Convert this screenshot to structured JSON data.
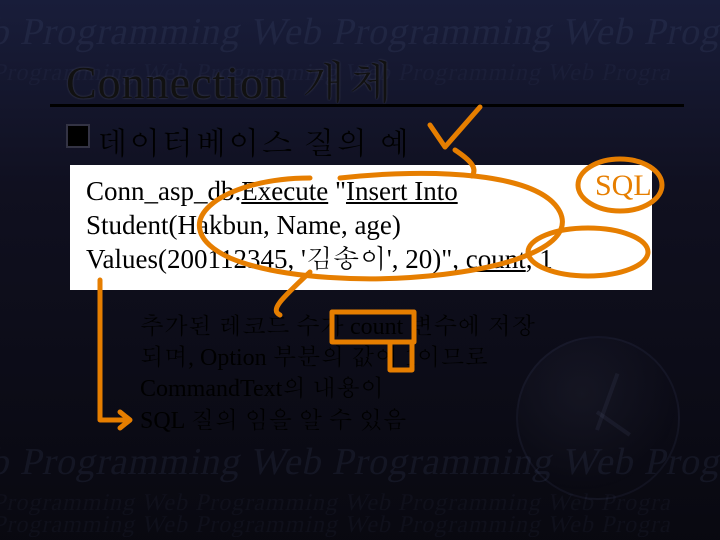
{
  "bg_repeat_text": "Web Programming Web Programming Web Programming Web Progra",
  "title": "Connection 개체",
  "bullet": "데이터베이스 질의 예",
  "code": {
    "part1": "Conn_asp_db.",
    "exec": "Execute",
    "part2": " \"",
    "insert": "Insert Into",
    "line2a": "Student(Hakbun, Name, age)",
    "line3a": "Values(200112345, '김송이', 20)\"",
    "line3b": ", ",
    "count": "count",
    "line3c": ", 1"
  },
  "note_sql": "SQL",
  "explain": {
    "l1a": "추가된 레코드 수가 ",
    "l1b": "count",
    "l1c": " 변수에 저장",
    "l2": "되며, Option 부분의 값이 1이므로",
    "l3": "CommandText의 내용이",
    "l4": "SQL 질의 임을 알 수 있음"
  }
}
